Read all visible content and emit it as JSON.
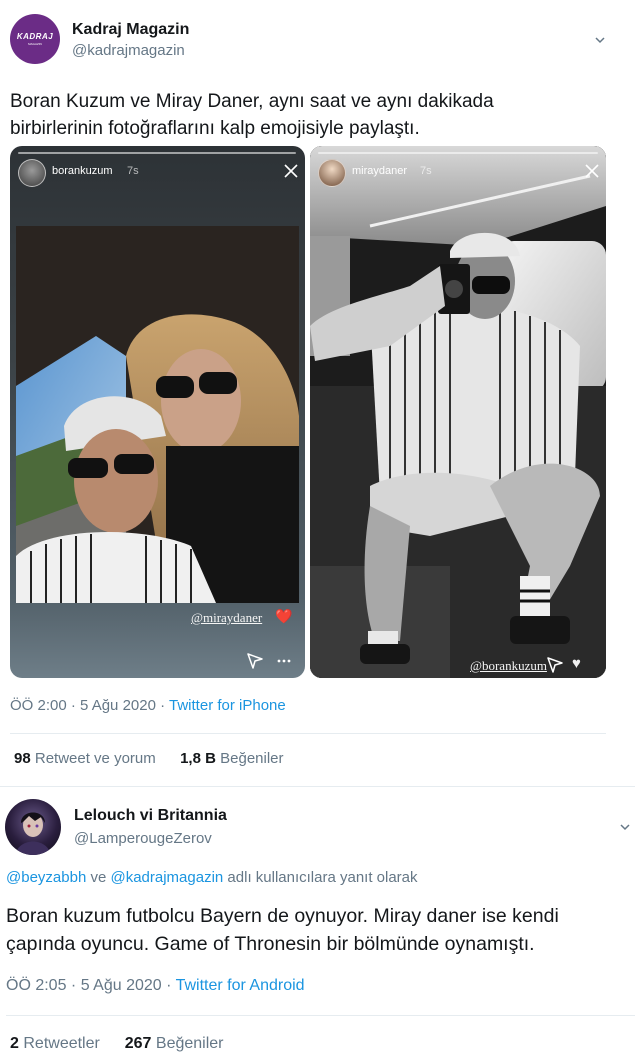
{
  "tweet1": {
    "display_name": "Kadraj Magazin",
    "handle": "@kadrajmagazin",
    "avatar_text": "KADRAJ",
    "avatar_subtext": "MAGAZIN",
    "text_line1": "Boran Kuzum ve Miray Daner, aynı saat ve aynı dakikada",
    "text_line2": "birbirlerinin fotoğraflarını kalp emojisiyle paylaştı.",
    "stories": [
      {
        "username": "borankuzum",
        "time": "7s",
        "mention": "@miraydaner",
        "heart": "❤️"
      },
      {
        "username": "miraydaner",
        "time": "7s",
        "mention": "@borankuzum",
        "heart": "♥"
      }
    ],
    "time": "ÖÖ 2:00 · 5 Ağu 2020",
    "separator": "·",
    "source": "Twitter for iPhone",
    "retweets_count": "98",
    "retweets_label": "Retweet ve yorum",
    "likes_count": "1,8 B",
    "likes_label": "Beğeniler"
  },
  "tweet2": {
    "display_name": "Lelouch vi Britannia",
    "handle": "@LamperougeZerov",
    "reply_user1": "@beyzabbh",
    "reply_and": "ve",
    "reply_user2": "@kadrajmagazin",
    "reply_suffix": "adlı kullanıcılara yanıt olarak",
    "text_line1": "Boran kuzum futbolcu Bayern de oynuyor. Miray daner ise kendi",
    "text_line2": "çapında oyuncu. Game of Thronesin bir bölmünde oynamıştı.",
    "time": "ÖÖ 2:05 · 5 Ağu 2020",
    "separator": "·",
    "source": "Twitter for Android",
    "retweets_count": "2",
    "retweets_label": "Retweetler",
    "likes_count": "267",
    "likes_label": "Beğeniler"
  },
  "colors": {
    "accent": "#1b95e0",
    "muted": "#657786",
    "brand_avatar": "#6b2c86"
  },
  "icons": [
    "chevron-down-icon",
    "close-icon",
    "send-icon",
    "more-icon",
    "heart-icon"
  ]
}
